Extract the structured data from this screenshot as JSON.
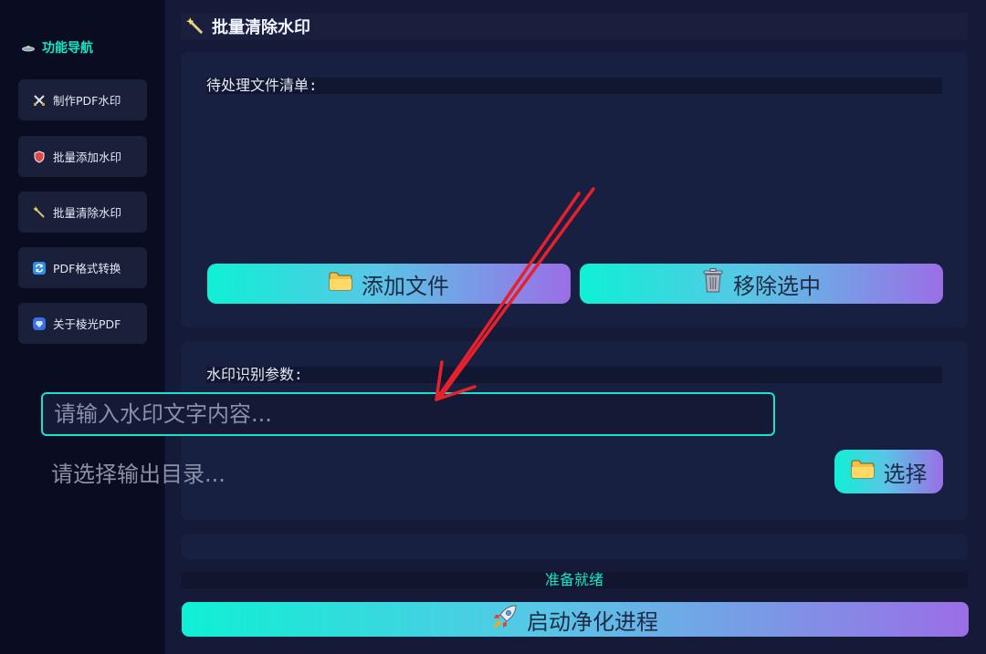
{
  "sidebar": {
    "title": "功能导航",
    "items": [
      {
        "label": "制作PDF水印"
      },
      {
        "label": "批量添加水印"
      },
      {
        "label": "批量清除水印"
      },
      {
        "label": "PDF格式转换"
      },
      {
        "label": "关于棱光PDF"
      }
    ]
  },
  "header": {
    "title": "批量清除水印"
  },
  "file_panel": {
    "label": "待处理文件清单:",
    "add_button": "添加文件",
    "remove_button": "移除选中"
  },
  "params_panel": {
    "label": "水印识别参数:",
    "watermark_placeholder": "请输入水印文字内容...",
    "output_dir_placeholder": "请选择输出目录...",
    "choose_button": "选择"
  },
  "status": "准备就绪",
  "start_button": "启动净化进程",
  "colors": {
    "accent": "#15e6c6",
    "gradient_start": "#0ff0d4",
    "gradient_end": "#9b6ee6",
    "annotation_arrow": "#e8202a"
  }
}
